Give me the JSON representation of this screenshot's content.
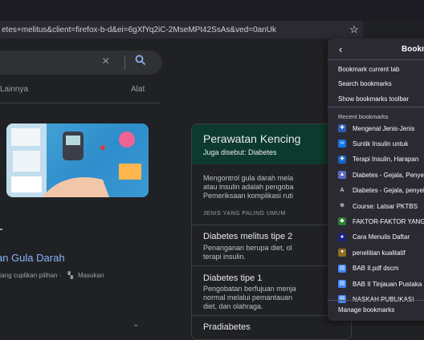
{
  "browser": {
    "url": "etes+melitus&client=firefox-b-d&ei=6gXfYq2iC-2MseMPI42SsAs&ved=0anUk",
    "star_icon": "star-icon"
  },
  "search": {
    "clear_icon": "×"
  },
  "tabs": {
    "more": "Lainnya",
    "tools": "Alat"
  },
  "snippet": {
    "title": "an Gula Darah",
    "meta": "tang cuplikan pilihan  ·",
    "feedback": "Masukan"
  },
  "knowledge_panel": {
    "title": "Perawatan Kencing",
    "subtitle": "Juga disebut: Diabetes",
    "body": [
      "Mengontrol gula darah mela",
      "atau insulin adalah pengoba",
      "Pemeriksaan komplikasi ruti"
    ],
    "caption": "JENIS YANG PALING UMUM",
    "sections": [
      {
        "title": "Diabetes melitus tipe 2",
        "body": [
          "Penanganan berupa diet, ol",
          "terapi insulin."
        ]
      },
      {
        "title": "Diabetes tipe 1",
        "body": [
          "Pengobatan berfujuan menja",
          "normal melalui pemantauan",
          "diet, dan olahraga."
        ]
      },
      {
        "title": "Pradiabetes",
        "body": []
      }
    ]
  },
  "bookmarks_menu": {
    "title": "Bookmarks",
    "actions": [
      "Bookmark current tab",
      "Search bookmarks",
      "Show bookmarks toolbar"
    ],
    "recent_label": "Recent bookmarks",
    "recent": [
      {
        "label": "Mengenal Jenis-Jenis",
        "icon": "doctor-icon",
        "color": "#2a5db0",
        "glyph": "✚"
      },
      {
        "label": "Suntik Insulin untuk",
        "icon": "dna-icon",
        "color": "#1a73e8",
        "glyph": "∞"
      },
      {
        "label": "Terapi Insulin, Harapan",
        "icon": "blue-square-icon",
        "color": "#1565c0",
        "glyph": "✚"
      },
      {
        "label": "Diabetes - Gejala, Penyebab",
        "icon": "alodokter-icon",
        "color": "#5c6bc0",
        "glyph": "▲"
      },
      {
        "label": "Diabetes - Gejala, penyebab",
        "icon": "a-icon",
        "color": "#2b2a33",
        "glyph": "A"
      },
      {
        "label": "Course: Latsar PKTBS",
        "icon": "globe-icon",
        "color": "#2b2a33",
        "glyph": "⊕"
      },
      {
        "label": "FAKTOR-FAKTOR YANG",
        "icon": "leaf-icon",
        "color": "#2e7d32",
        "glyph": "◆"
      },
      {
        "label": "Cara Menulis Daftar",
        "icon": "dark-circle-icon",
        "color": "#1a237e",
        "glyph": "●"
      },
      {
        "label": "penelitian kualitatif",
        "icon": "crest-icon",
        "color": "#8d6e20",
        "glyph": "✦"
      },
      {
        "label": "BAB II.pdf dscm",
        "icon": "document-icon",
        "color": "#4285f4",
        "glyph": "▤"
      },
      {
        "label": "BAB II Tinjauan Pustaka",
        "icon": "document-icon",
        "color": "#4285f4",
        "glyph": "▤"
      },
      {
        "label": "NASKAH PUBLIKASI",
        "icon": "document-icon",
        "color": "#4285f4",
        "glyph": "▤"
      }
    ],
    "manage": "Manage bookmarks"
  }
}
